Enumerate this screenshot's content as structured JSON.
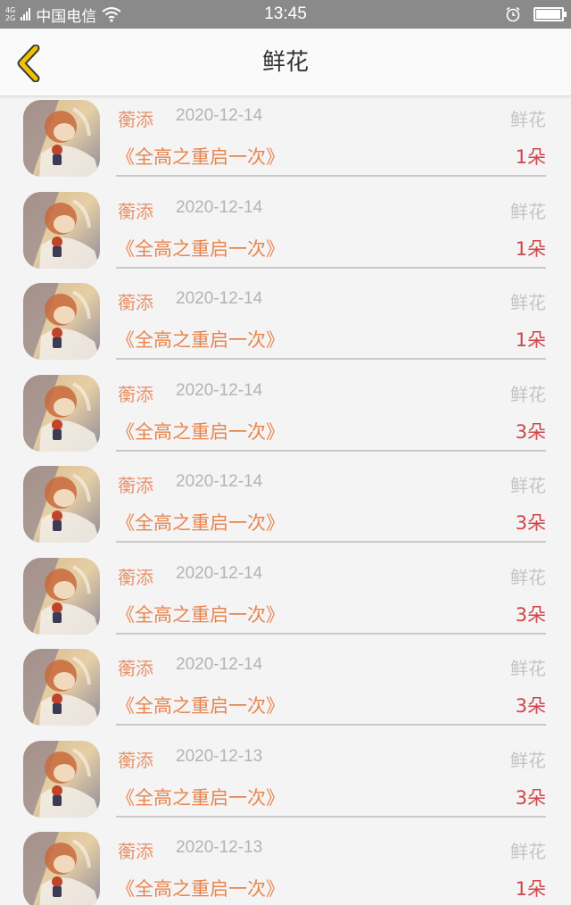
{
  "status_bar": {
    "network_top": "4G",
    "network_bottom": "2G",
    "carrier": "中国电信",
    "time": "13:45",
    "battery_level": 0.95,
    "icons": [
      "signal-icon",
      "wifi-icon",
      "alarm-icon",
      "battery-icon"
    ]
  },
  "header": {
    "title": "鲜花",
    "back_icon": "chevron-left-icon",
    "accent_color": "#f2c200"
  },
  "colors": {
    "name": "#e8926a",
    "date": "#b4b4b4",
    "gift_type": "#c4c4c4",
    "book": "#e8844e",
    "count": "#d0454a"
  },
  "records": [
    {
      "name": "蘅添",
      "date": "2020-12-14",
      "gift_type": "鲜花",
      "book": "《全高之重启一次》",
      "count": "1朵"
    },
    {
      "name": "蘅添",
      "date": "2020-12-14",
      "gift_type": "鲜花",
      "book": "《全高之重启一次》",
      "count": "1朵"
    },
    {
      "name": "蘅添",
      "date": "2020-12-14",
      "gift_type": "鲜花",
      "book": "《全高之重启一次》",
      "count": "1朵"
    },
    {
      "name": "蘅添",
      "date": "2020-12-14",
      "gift_type": "鲜花",
      "book": "《全高之重启一次》",
      "count": "3朵"
    },
    {
      "name": "蘅添",
      "date": "2020-12-14",
      "gift_type": "鲜花",
      "book": "《全高之重启一次》",
      "count": "3朵"
    },
    {
      "name": "蘅添",
      "date": "2020-12-14",
      "gift_type": "鲜花",
      "book": "《全高之重启一次》",
      "count": "3朵"
    },
    {
      "name": "蘅添",
      "date": "2020-12-14",
      "gift_type": "鲜花",
      "book": "《全高之重启一次》",
      "count": "3朵"
    },
    {
      "name": "蘅添",
      "date": "2020-12-13",
      "gift_type": "鲜花",
      "book": "《全高之重启一次》",
      "count": "3朵"
    },
    {
      "name": "蘅添",
      "date": "2020-12-13",
      "gift_type": "鲜花",
      "book": "《全高之重启一次》",
      "count": "1朵"
    }
  ]
}
